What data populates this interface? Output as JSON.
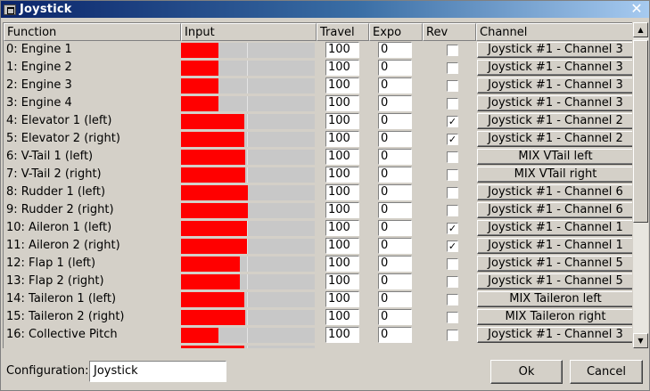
{
  "window": {
    "title": "Joystick",
    "close_glyph": "✕"
  },
  "columns": [
    "Function",
    "Input",
    "Travel",
    "Expo",
    "Rev",
    "Channel"
  ],
  "rows": [
    {
      "function": "0: Engine 1",
      "input": 0.28,
      "travel": "100",
      "expo": "0",
      "rev": false,
      "channel": "Joystick #1 - Channel 3"
    },
    {
      "function": "1: Engine 2",
      "input": 0.28,
      "travel": "100",
      "expo": "0",
      "rev": false,
      "channel": "Joystick #1 - Channel 3"
    },
    {
      "function": "2: Engine 3",
      "input": 0.28,
      "travel": "100",
      "expo": "0",
      "rev": false,
      "channel": "Joystick #1 - Channel 3"
    },
    {
      "function": "3: Engine 4",
      "input": 0.28,
      "travel": "100",
      "expo": "0",
      "rev": false,
      "channel": "Joystick #1 - Channel 3"
    },
    {
      "function": "4: Elevator 1 (left)",
      "input": 0.47,
      "travel": "100",
      "expo": "0",
      "rev": true,
      "channel": "Joystick #1 - Channel 2"
    },
    {
      "function": "5: Elevator 2 (right)",
      "input": 0.47,
      "travel": "100",
      "expo": "0",
      "rev": true,
      "channel": "Joystick #1 - Channel 2"
    },
    {
      "function": "6: V-Tail 1 (left)",
      "input": 0.48,
      "travel": "100",
      "expo": "0",
      "rev": false,
      "channel": "MIX VTail left"
    },
    {
      "function": "7: V-Tail 2 (right)",
      "input": 0.48,
      "travel": "100",
      "expo": "0",
      "rev": false,
      "channel": "MIX VTail right"
    },
    {
      "function": "8: Rudder 1 (left)",
      "input": 0.5,
      "travel": "100",
      "expo": "0",
      "rev": false,
      "channel": "Joystick #1 - Channel 6"
    },
    {
      "function": "9: Rudder 2 (right)",
      "input": 0.5,
      "travel": "100",
      "expo": "0",
      "rev": false,
      "channel": "Joystick #1 - Channel 6"
    },
    {
      "function": "10: Aileron 1 (left)",
      "input": 0.49,
      "travel": "100",
      "expo": "0",
      "rev": true,
      "channel": "Joystick #1 - Channel 1"
    },
    {
      "function": "11: Aileron 2 (right)",
      "input": 0.49,
      "travel": "100",
      "expo": "0",
      "rev": true,
      "channel": "Joystick #1 - Channel 1"
    },
    {
      "function": "12: Flap 1 (left)",
      "input": 0.44,
      "travel": "100",
      "expo": "0",
      "rev": false,
      "channel": "Joystick #1 - Channel 5"
    },
    {
      "function": "13: Flap 2 (right)",
      "input": 0.44,
      "travel": "100",
      "expo": "0",
      "rev": false,
      "channel": "Joystick #1 - Channel 5"
    },
    {
      "function": "14: Taileron 1 (left)",
      "input": 0.47,
      "travel": "100",
      "expo": "0",
      "rev": false,
      "channel": "MIX Taileron left"
    },
    {
      "function": "15: Taileron 2 (right)",
      "input": 0.48,
      "travel": "100",
      "expo": "0",
      "rev": false,
      "channel": "MIX Taileron right"
    },
    {
      "function": "16: Collective Pitch",
      "input": 0.28,
      "travel": "100",
      "expo": "0",
      "rev": false,
      "channel": "Joystick #1 - Channel 3"
    },
    {
      "function": "",
      "input": 0.47,
      "travel": "",
      "expo": "",
      "rev": false,
      "channel": ""
    }
  ],
  "checkmark_glyph": "✓",
  "scrollbar": {
    "up_glyph": "▲",
    "down_glyph": "▼"
  },
  "footer": {
    "config_label": "Configuration:",
    "config_value": "Joystick",
    "ok_label": "Ok",
    "cancel_label": "Cancel"
  }
}
